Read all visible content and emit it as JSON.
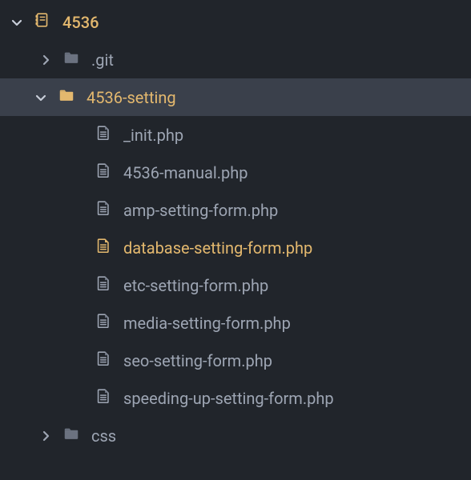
{
  "root": {
    "label": "4536"
  },
  "items": [
    {
      "key": "git",
      "indent": 1,
      "type": "folder",
      "expanded": false,
      "label": ".git"
    },
    {
      "key": "setting",
      "indent": 2,
      "type": "folder",
      "expanded": true,
      "label": "4536-setting",
      "highlight": true,
      "openAccent": true
    },
    {
      "key": "init",
      "indent": 3,
      "type": "file",
      "label": "_init.php"
    },
    {
      "key": "manual",
      "indent": 3,
      "type": "file",
      "label": "4536-manual.php"
    },
    {
      "key": "amp",
      "indent": 3,
      "type": "file",
      "label": "amp-setting-form.php"
    },
    {
      "key": "db",
      "indent": 3,
      "type": "file",
      "label": "database-setting-form.php",
      "active": true
    },
    {
      "key": "etc",
      "indent": 3,
      "type": "file",
      "label": "etc-setting-form.php"
    },
    {
      "key": "media",
      "indent": 3,
      "type": "file",
      "label": "media-setting-form.php"
    },
    {
      "key": "seo",
      "indent": 3,
      "type": "file",
      "label": "seo-setting-form.php"
    },
    {
      "key": "speed",
      "indent": 3,
      "type": "file",
      "label": "speeding-up-setting-form.php"
    },
    {
      "key": "css",
      "indent": 1,
      "type": "folder",
      "expanded": false,
      "label": "css"
    }
  ]
}
